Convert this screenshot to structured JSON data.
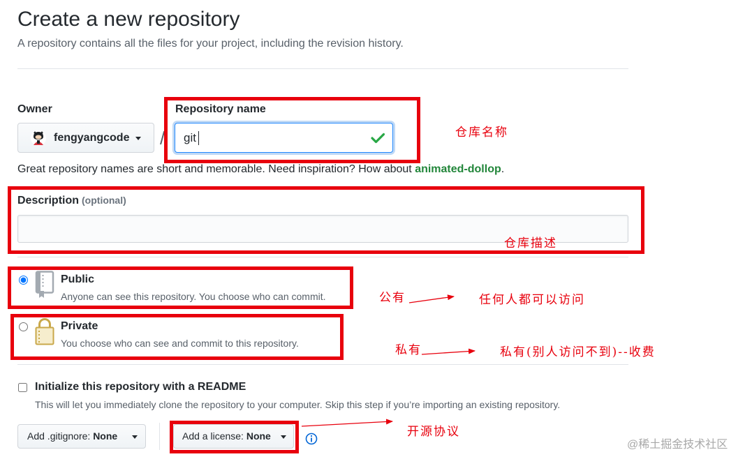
{
  "header": {
    "title": "Create a new repository",
    "subtitle": "A repository contains all the files for your project, including the revision history."
  },
  "owner": {
    "label": "Owner",
    "value": "fengyangcode",
    "avatar_icon": "octocat-avatar-icon",
    "caret_icon": "caret-down-icon"
  },
  "separator": "/",
  "repo_name": {
    "label": "Repository name",
    "value": "git",
    "status_icon": "check-icon"
  },
  "name_hint": {
    "text": "Great repository names are short and memorable. Need inspiration? How about ",
    "suggestion": "animated-dollop",
    "suffix": "."
  },
  "description": {
    "label": "Description",
    "optional": "(optional)",
    "value": ""
  },
  "visibility": {
    "options": [
      {
        "title": "Public",
        "desc": "Anyone can see this repository. You choose who can commit.",
        "icon": "repo-book-icon",
        "checked": true
      },
      {
        "title": "Private",
        "desc": "You choose who can see and commit to this repository.",
        "icon": "lock-icon",
        "checked": false
      }
    ]
  },
  "readme": {
    "label": "Initialize this repository with a README",
    "desc": "This will let you immediately clone the repository to your computer. Skip this step if you’re importing an existing repository.",
    "checked": false
  },
  "gitignore": {
    "label": "Add .gitignore:",
    "value": "None"
  },
  "license": {
    "label": "Add a license:",
    "value": "None",
    "info_icon": "info-icon"
  },
  "annotations": {
    "repo_name": "仓库名称",
    "description": "仓库描述",
    "public_label": "公有",
    "public_note": "任何人都可以访问",
    "private_label": "私有",
    "private_note": "私有(别人访问不到)--收费",
    "license": "开源协议"
  },
  "watermark": "@稀土掘金技术社区",
  "colors": {
    "annotation_red": "#e8000d",
    "suggestion_green": "#22863a",
    "info_blue": "#0366d6",
    "focus_blue": "#2188ff",
    "check_green": "#28a745"
  }
}
